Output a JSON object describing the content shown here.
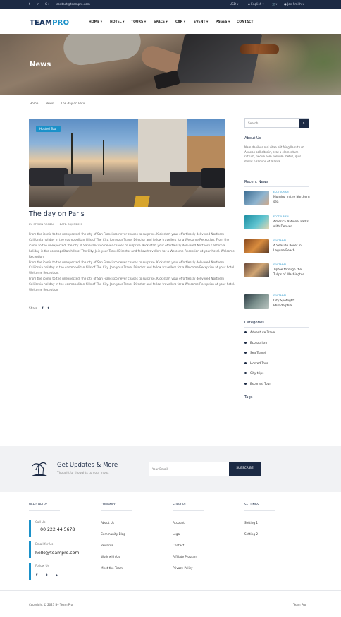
{
  "topbar": {
    "email": "contact@teampro.com",
    "currency": "USD",
    "language": "English",
    "user": "Joe Smith"
  },
  "nav": {
    "logo_team": "TEAM",
    "logo_pro": "PRO",
    "items": [
      {
        "label": "HOME ▾"
      },
      {
        "label": "HOTEL ▾"
      },
      {
        "label": "TOURS ▾"
      },
      {
        "label": "SPACE ▾"
      },
      {
        "label": "CAR ▾"
      },
      {
        "label": "EVENT ▾"
      },
      {
        "label": "PAGES ▾"
      },
      {
        "label": "CONTACT"
      }
    ]
  },
  "hero": {
    "title": "News"
  },
  "breadcrumb": [
    "Home",
    "News",
    "The day on Paris"
  ],
  "article": {
    "tag": "Hosted Tour",
    "title": "The day on Paris",
    "author": "BY: STEFEN ROMEN",
    "date": "DATE: 03/03/2021",
    "paragraphs": [
      "From the iconic to the unexpected, the city of San Francisco never ceases to surprise. Kick-start your effortlessly delivered Northern California holiday in the cosmopolitan hills of The City. Join your Travel Director and fellow travellers for a Welcome Reception. From the iconic to the unexpected, the city of San Francisco never ceases to surprise. Kick-start your effortlessly delivered Northern California holiday in the cosmopolitan hills of The City. Join your Travel Director and fellow travellers for a Welcome Reception at your hotel. Welcome Reception",
      "From the iconic to the unexpected, the city of San Francisco never ceases to surprise. Kick-start your effortlessly delivered Northern California holiday in the cosmopolitan hills of The City. Join your Travel Director and fellow travellers for a Welcome Reception at your hotel. Welcome Reception.",
      "From the iconic to the unexpected, the city of San Francisco never ceases to surprise. Kick-start your effortlessly delivered Northern California holiday in the cosmopolitan hills of The City. Join your Travel Director and fellow travellers for a Welcome Reception at your hotel. Welcome Reception"
    ],
    "share_label": "Share"
  },
  "sidebar": {
    "search_placeholder": "Search ...",
    "about_title": "About Us",
    "about_text": "Nam dapibus nisi vitae elit fringilla rutrum. Aenean sollicitudin, erat a elementum rutrum, neque sem pretium metus, quis mollis nisl nunc et massa",
    "recent_title": "Recent News",
    "recent": [
      {
        "cat": "ECOTOURISM",
        "title": "Morning in the Northern sea"
      },
      {
        "cat": "ECOTOURISM",
        "title": "America National Parks with Denver"
      },
      {
        "cat": "SEA TRAVEL",
        "title": "A Seaside Reset in Laguna Beach"
      },
      {
        "cat": "SEA TRAVEL",
        "title": "Tiptoe through the Tulips of Washington"
      },
      {
        "cat": "SEA TRAVEL",
        "title": "City Spotlight: Philadelphia"
      }
    ],
    "categories_title": "Categories",
    "categories": [
      "Adventure Travel",
      "Ecotourism",
      "Sea Travel",
      "Hosted Tour",
      "City trips",
      "Escorted Tour"
    ],
    "tags_title": "Tags"
  },
  "newsletter": {
    "title": "Get Updates & More",
    "subtitle": "Thoughtful thoughts to your inbox",
    "placeholder": "Your Email",
    "button": "SUBSCRIBE"
  },
  "footer": {
    "need_help": "NEED HELP?",
    "call_label": "Call Us",
    "phone": "+ 00 222 44 5678",
    "email_label": "Email for Us",
    "email": "hello@teampro.com",
    "follow_label": "Follow Us",
    "company": "COMPANY",
    "company_links": [
      "About Us",
      "Community Blog",
      "Rewards",
      "Work with Us",
      "Meet the Team"
    ],
    "support": "SUPPORT",
    "support_links": [
      "Account",
      "Legal",
      "Contact",
      "Affiliate Program",
      "Privacy Policy"
    ],
    "settings": "SETTINGS",
    "settings_links": [
      "Setting 1",
      "Setting 2"
    ],
    "copyright": "Copyright © 2021 By Team Pro",
    "brand": "Team Pro"
  },
  "colors": {
    "navy": "#1c2a44",
    "accent": "#1b91c9"
  }
}
